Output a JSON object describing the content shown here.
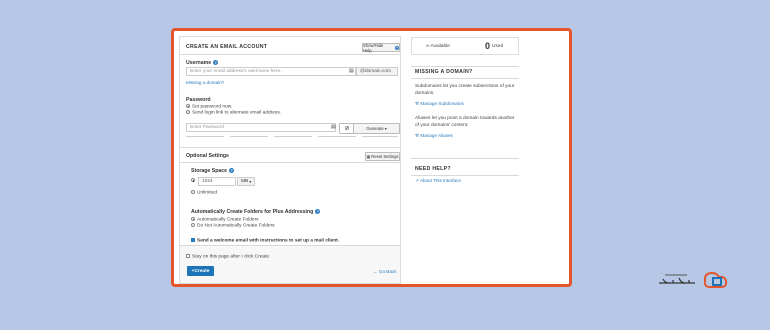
{
  "form": {
    "title": "CREATE AN EMAIL ACCOUNT",
    "show_hide_help": "Show/Hide Help",
    "username": {
      "label": "Username",
      "placeholder": "Enter your email address's username here.",
      "domain": "@domain.com",
      "missing_domain_link": "Missing a domain?"
    },
    "password": {
      "label": "Password",
      "option_set": "Set password now.",
      "option_send": "Send login link to alternate email address.",
      "placeholder": "Enter Password",
      "generate_label": "Generate"
    },
    "optional": {
      "label": "Optional Settings",
      "reset_label": "Reset Settings",
      "storage_label": "Storage Space",
      "storage_value": "1024",
      "storage_unit": "MB",
      "unlimited": "Unlimited",
      "folders_label": "Automatically Create Folders for Plus Addressing",
      "folders_auto": "Automatically Create Folders",
      "folders_none": "Do Not Automatically Create Folders",
      "welcome": "Send a welcome email with instructions to set up a mail client."
    },
    "stay_on_page": "Stay on this page after I click Create.",
    "create_label": "Create",
    "go_back_label": "Go Back"
  },
  "sidebar": {
    "available_label": "Available",
    "used_count": "0",
    "used_label": "Used",
    "missing_domain": {
      "title": "MISSING A DOMAIN?",
      "text1": "Subdomains let you create subsections of your domains.",
      "link1": "Manage Subdomains",
      "text2": "Aliases let you point a domain towards another of your domains' content.",
      "link2": "Manage Aliases"
    },
    "need_help": {
      "title": "NEED HELP?",
      "link": "About This Interface"
    }
  },
  "colors": {
    "background": "#b6c8e6",
    "frame_border": "#e5562e",
    "primary": "#1d75b8",
    "link": "#2a7ac0"
  }
}
